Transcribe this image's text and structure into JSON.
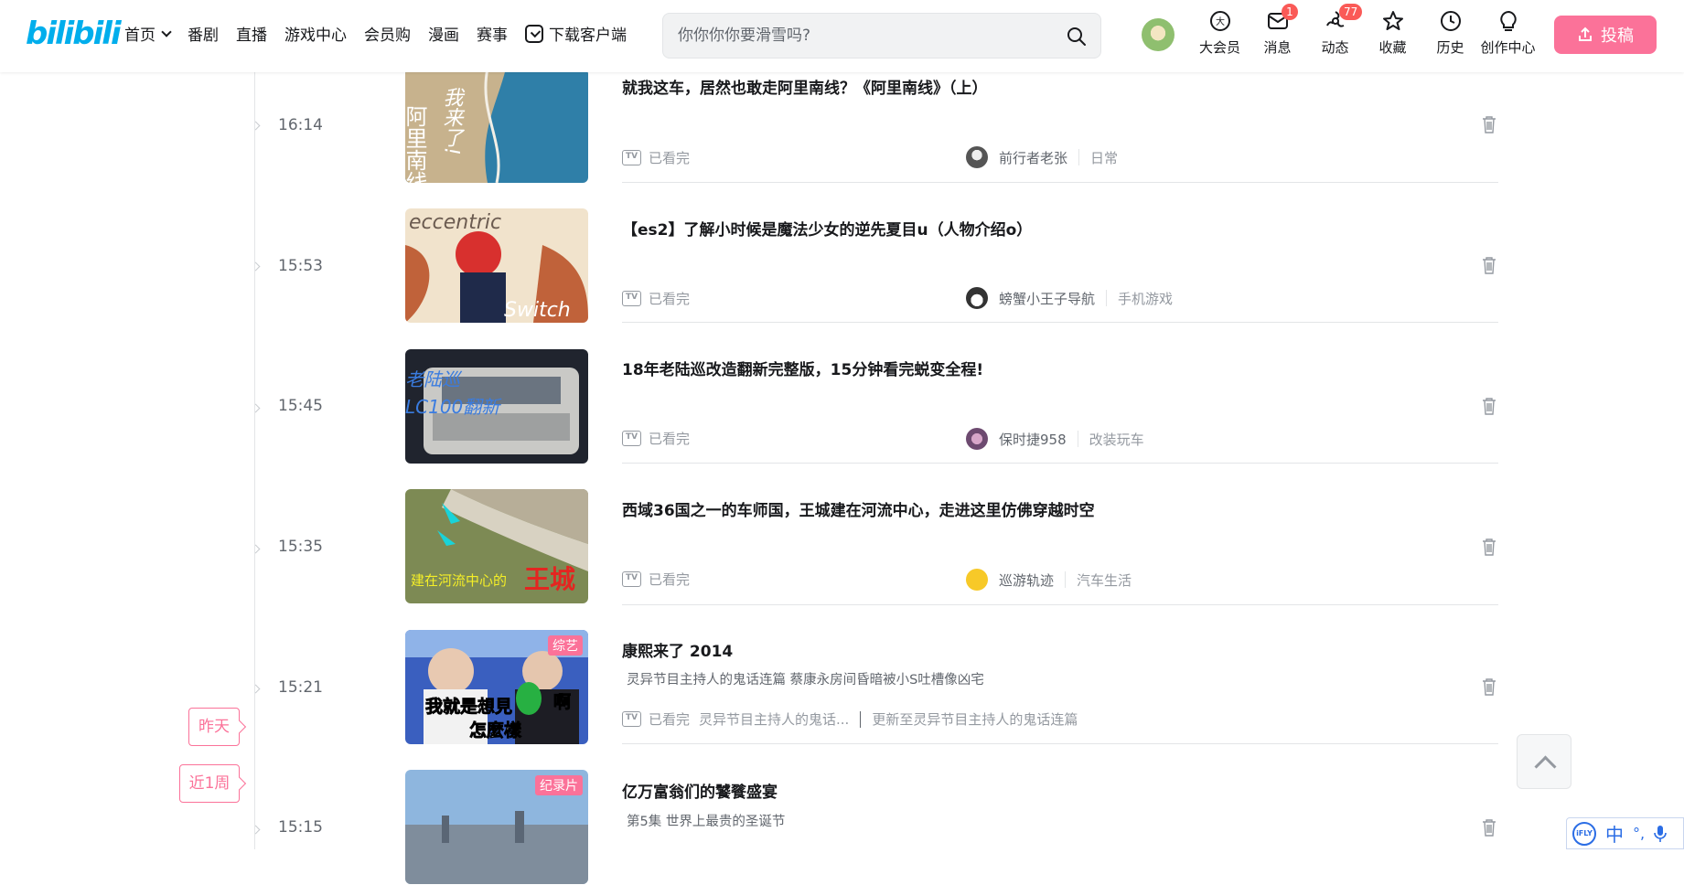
{
  "header": {
    "logo": "bilibili",
    "nav": [
      {
        "label": "首页",
        "has_dropdown": true
      },
      {
        "label": "番剧"
      },
      {
        "label": "直播"
      },
      {
        "label": "游戏中心"
      },
      {
        "label": "会员购"
      },
      {
        "label": "漫画"
      },
      {
        "label": "赛事"
      },
      {
        "label": "下载客户端",
        "icon": "download-icon"
      }
    ],
    "search": {
      "placeholder": "你你你你要滑雪吗?"
    },
    "right_menu": [
      {
        "label": "大会员",
        "icon": "vip-icon"
      },
      {
        "label": "消息",
        "icon": "message-icon",
        "badge": "1"
      },
      {
        "label": "动态",
        "icon": "dynamic-icon",
        "badge": "77"
      },
      {
        "label": "收藏",
        "icon": "star-icon"
      },
      {
        "label": "历史",
        "icon": "clock-icon"
      },
      {
        "label": "创作中心",
        "icon": "bulb-icon"
      }
    ],
    "upload_label": "投稿",
    "colors": {
      "brand": "#00aeec",
      "accent": "#fb7299",
      "badge": "#fa5a57"
    }
  },
  "history": [
    {
      "time": "16:14",
      "title": "就我这车，居然也敢走阿里南线？《阿里南线》（上）",
      "status": "已看完",
      "uploader": "前行者老张",
      "category": "日常",
      "desc": ""
    },
    {
      "time": "15:53",
      "title": "【es2】了解小时候是魔法少女的逆先夏目u（人物介绍o）",
      "status": "已看完",
      "uploader": "螃蟹小王子导航",
      "category": "手机游戏",
      "desc": ""
    },
    {
      "time": "15:45",
      "title": "18年老陆巡改造翻新完整版，15分钟看完蜕变全程!",
      "status": "已看完",
      "uploader": "保时捷958",
      "category": "改装玩车",
      "desc": ""
    },
    {
      "time": "15:35",
      "title": "西域36国之一的车师国，王城建在河流中心，走进这里仿佛穿越时空",
      "status": "已看完",
      "uploader": "巡游轨迹",
      "category": "汽车生活",
      "desc": ""
    },
    {
      "time": "15:21",
      "title": "康熙来了 2014",
      "status": "已看完",
      "uploader": "灵异节目主持人的鬼话...",
      "category": "更新至灵异节目主持人的鬼话连篇",
      "desc": "灵异节目主持人的鬼话连篇 蔡康永房间昏暗被小S吐槽像凶宅",
      "tag": "综艺"
    },
    {
      "time": "15:15",
      "title": "亿万富翁们的饕餮盛宴",
      "status": "",
      "uploader": "",
      "category": "",
      "desc": "第5集 世界上最贵的圣诞节",
      "tag": "纪录片"
    }
  ],
  "thumb_text": {
    "t0": "阿里南线",
    "t0b": "我来了!",
    "t1a": "eccentric",
    "t1b": "Switch",
    "t2a": "老陆巡",
    "t2b": "LC100翻新",
    "t3a": "建在河流中心的",
    "t3b": "王城",
    "t4a": "我就是想見",
    "t4b": "啊",
    "t4c": "怎麼樣"
  },
  "side_labels": {
    "yesterday": "昨天",
    "week": "近1周"
  },
  "ime": {
    "logo": "iFLY",
    "lang": "中"
  }
}
